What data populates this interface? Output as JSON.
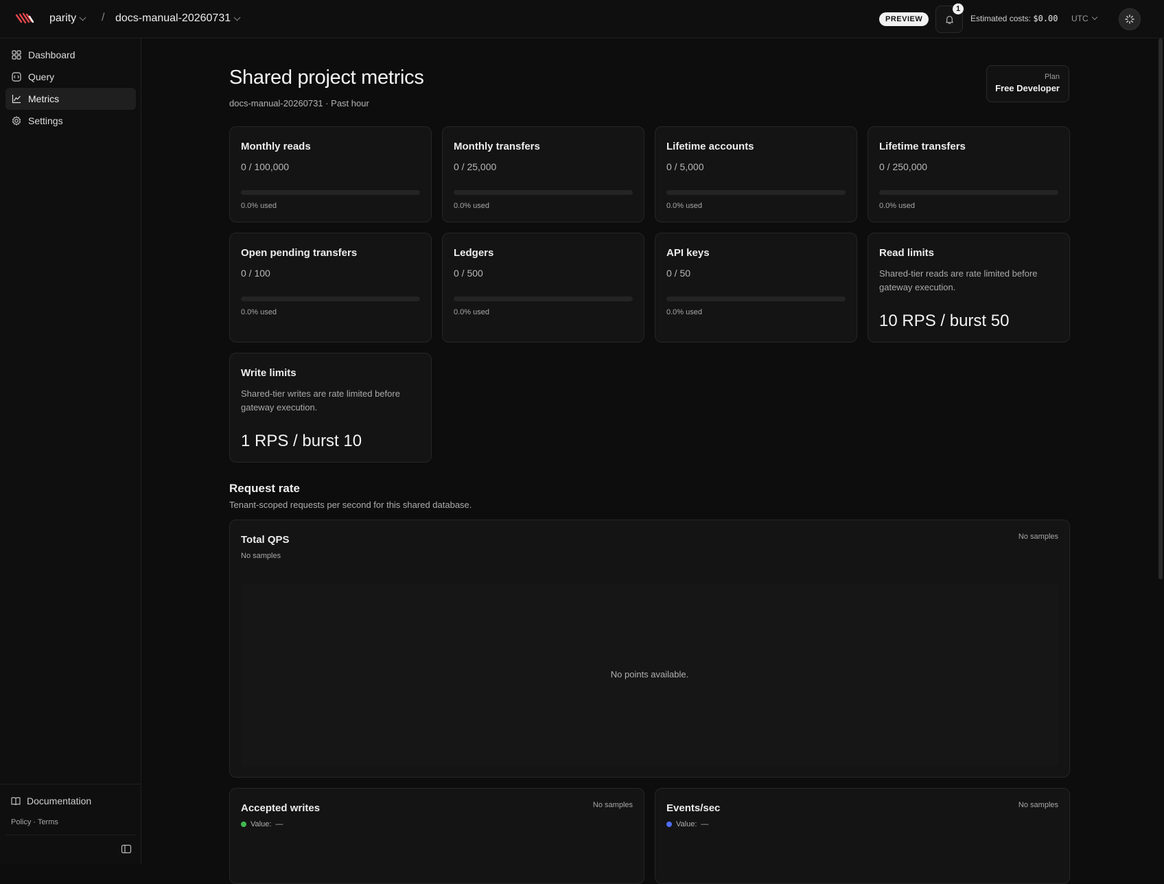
{
  "header": {
    "org_name": "parity",
    "separator": "/",
    "project_name": "docs-manual-20260731",
    "preview_badge": "PREVIEW",
    "notification_count": "1",
    "estimated_costs_label": "Estimated costs:",
    "estimated_costs_value": "$0.00",
    "timezone": "UTC"
  },
  "sidebar": {
    "items": [
      {
        "label": "Dashboard",
        "icon": "grid-icon",
        "active": false
      },
      {
        "label": "Query",
        "icon": "query-icon",
        "active": false
      },
      {
        "label": "Metrics",
        "icon": "chart-line-icon",
        "active": true
      },
      {
        "label": "Settings",
        "icon": "gear-icon",
        "active": false
      }
    ],
    "documentation": "Documentation",
    "policy": "Policy",
    "policy_sep": "·",
    "terms": "Terms"
  },
  "page": {
    "title": "Shared project metrics",
    "subtitle": "docs-manual-20260731 · Past hour",
    "plan_label": "Plan",
    "plan_value": "Free Developer"
  },
  "metrics": [
    {
      "title": "Monthly reads",
      "value": "0 / 100,000",
      "used": "0.0% used",
      "fraction": 0
    },
    {
      "title": "Monthly transfers",
      "value": "0 / 25,000",
      "used": "0.0% used",
      "fraction": 0
    },
    {
      "title": "Lifetime accounts",
      "value": "0 / 5,000",
      "used": "0.0% used",
      "fraction": 0
    },
    {
      "title": "Lifetime transfers",
      "value": "0 / 250,000",
      "used": "0.0% used",
      "fraction": 0
    },
    {
      "title": "Open pending transfers",
      "value": "0 / 100",
      "used": "0.0% used",
      "fraction": 0
    },
    {
      "title": "Ledgers",
      "value": "0 / 500",
      "used": "0.0% used",
      "fraction": 0
    },
    {
      "title": "API keys",
      "value": "0 / 50",
      "used": "0.0% used",
      "fraction": 0
    }
  ],
  "limits": {
    "read": {
      "title": "Read limits",
      "desc": "Shared-tier reads are rate limited before gateway execution.",
      "value": "10 RPS / burst 50"
    },
    "write": {
      "title": "Write limits",
      "desc": "Shared-tier writes are rate limited before gateway execution.",
      "value": "1 RPS / burst 10"
    }
  },
  "request_rate": {
    "title": "Request rate",
    "subtitle": "Tenant-scoped requests per second for this shared database.",
    "total_qps": {
      "title": "Total QPS",
      "sub": "No samples",
      "status": "No samples",
      "empty": "No points available."
    },
    "accepted_writes": {
      "title": "Accepted writes",
      "legend_label": "Value:",
      "legend_value": "—",
      "status": "No samples",
      "color": "#3fb950"
    },
    "events_sec": {
      "title": "Events/sec",
      "legend_label": "Value:",
      "legend_value": "—",
      "status": "No samples",
      "color": "#4f6ef7"
    }
  }
}
